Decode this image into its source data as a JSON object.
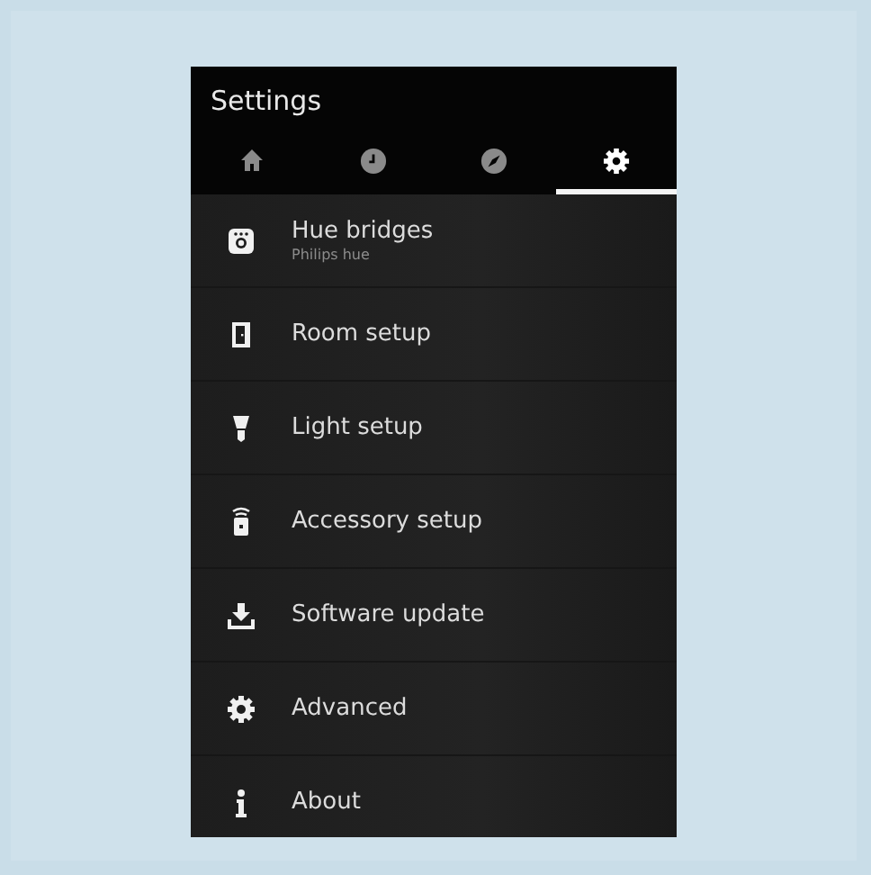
{
  "header": {
    "title": "Settings"
  },
  "tabs": [
    {
      "selected": false
    },
    {
      "selected": false
    },
    {
      "selected": false
    },
    {
      "selected": true
    }
  ],
  "items": [
    {
      "label": "Hue bridges",
      "sublabel": "Philips hue"
    },
    {
      "label": "Room setup"
    },
    {
      "label": "Light setup"
    },
    {
      "label": "Accessory setup"
    },
    {
      "label": "Software update"
    },
    {
      "label": "Advanced"
    },
    {
      "label": "About"
    }
  ]
}
